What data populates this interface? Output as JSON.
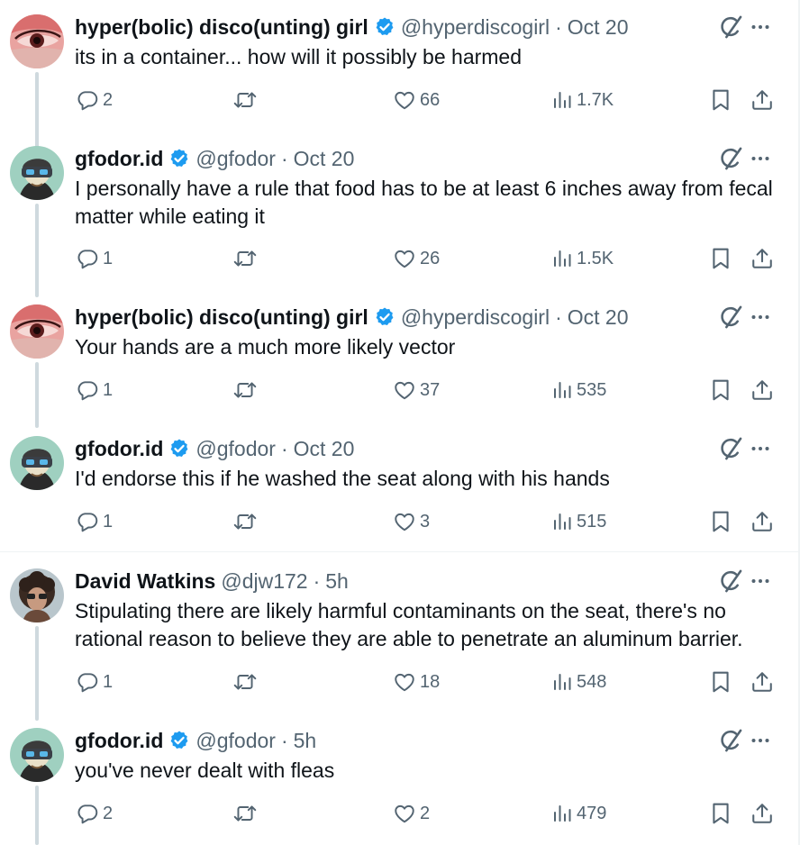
{
  "tweets": [
    {
      "name": "hyper(bolic) disco(unting) girl",
      "verified": true,
      "handle": "@hyperdiscogirl",
      "time": "Oct 20",
      "text": "its in a container... how will it possibly be harmed",
      "replies": "2",
      "retweets": "",
      "likes": "66",
      "views": "1.7K",
      "avatar": "eye"
    },
    {
      "name": "gfodor.id",
      "verified": true,
      "handle": "@gfodor",
      "time": "Oct 20",
      "text": "I personally have a rule that food has to be at least 6 inches away from fecal\nmatter while eating it",
      "replies": "1",
      "retweets": "",
      "likes": "26",
      "views": "1.5K",
      "avatar": "vr"
    },
    {
      "name": "hyper(bolic) disco(unting) girl",
      "verified": true,
      "handle": "@hyperdiscogirl",
      "time": "Oct 20",
      "text": "Your hands are a much more likely vector",
      "replies": "1",
      "retweets": "",
      "likes": "37",
      "views": "535",
      "avatar": "eye"
    },
    {
      "name": "gfodor.id",
      "verified": true,
      "handle": "@gfodor",
      "time": "Oct 20",
      "text": "I'd endorse this if he washed the seat along with his hands",
      "replies": "1",
      "retweets": "",
      "likes": "3",
      "views": "515",
      "avatar": "vr"
    },
    {
      "name": "David Watkins",
      "verified": false,
      "handle": "@djw172",
      "time": "5h",
      "text": "Stipulating there are likely harmful contaminants on the seat, there's no\nrational reason to believe they are able to penetrate an aluminum barrier.",
      "replies": "1",
      "retweets": "",
      "likes": "18",
      "views": "548",
      "avatar": "curly"
    },
    {
      "name": "gfodor.id",
      "verified": true,
      "handle": "@gfodor",
      "time": "5h",
      "text": "you've never dealt with fleas",
      "replies": "2",
      "retweets": "",
      "likes": "2",
      "views": "479",
      "avatar": "vr"
    }
  ],
  "colors": {
    "verified": "#1d9bf0",
    "secondary_text": "#536471",
    "thread_line": "#cfd9de"
  },
  "icons": [
    "reply-icon",
    "retweet-icon",
    "like-icon",
    "views-icon",
    "bookmark-icon",
    "share-icon",
    "grok-icon",
    "more-icon",
    "verified-badge-icon"
  ]
}
